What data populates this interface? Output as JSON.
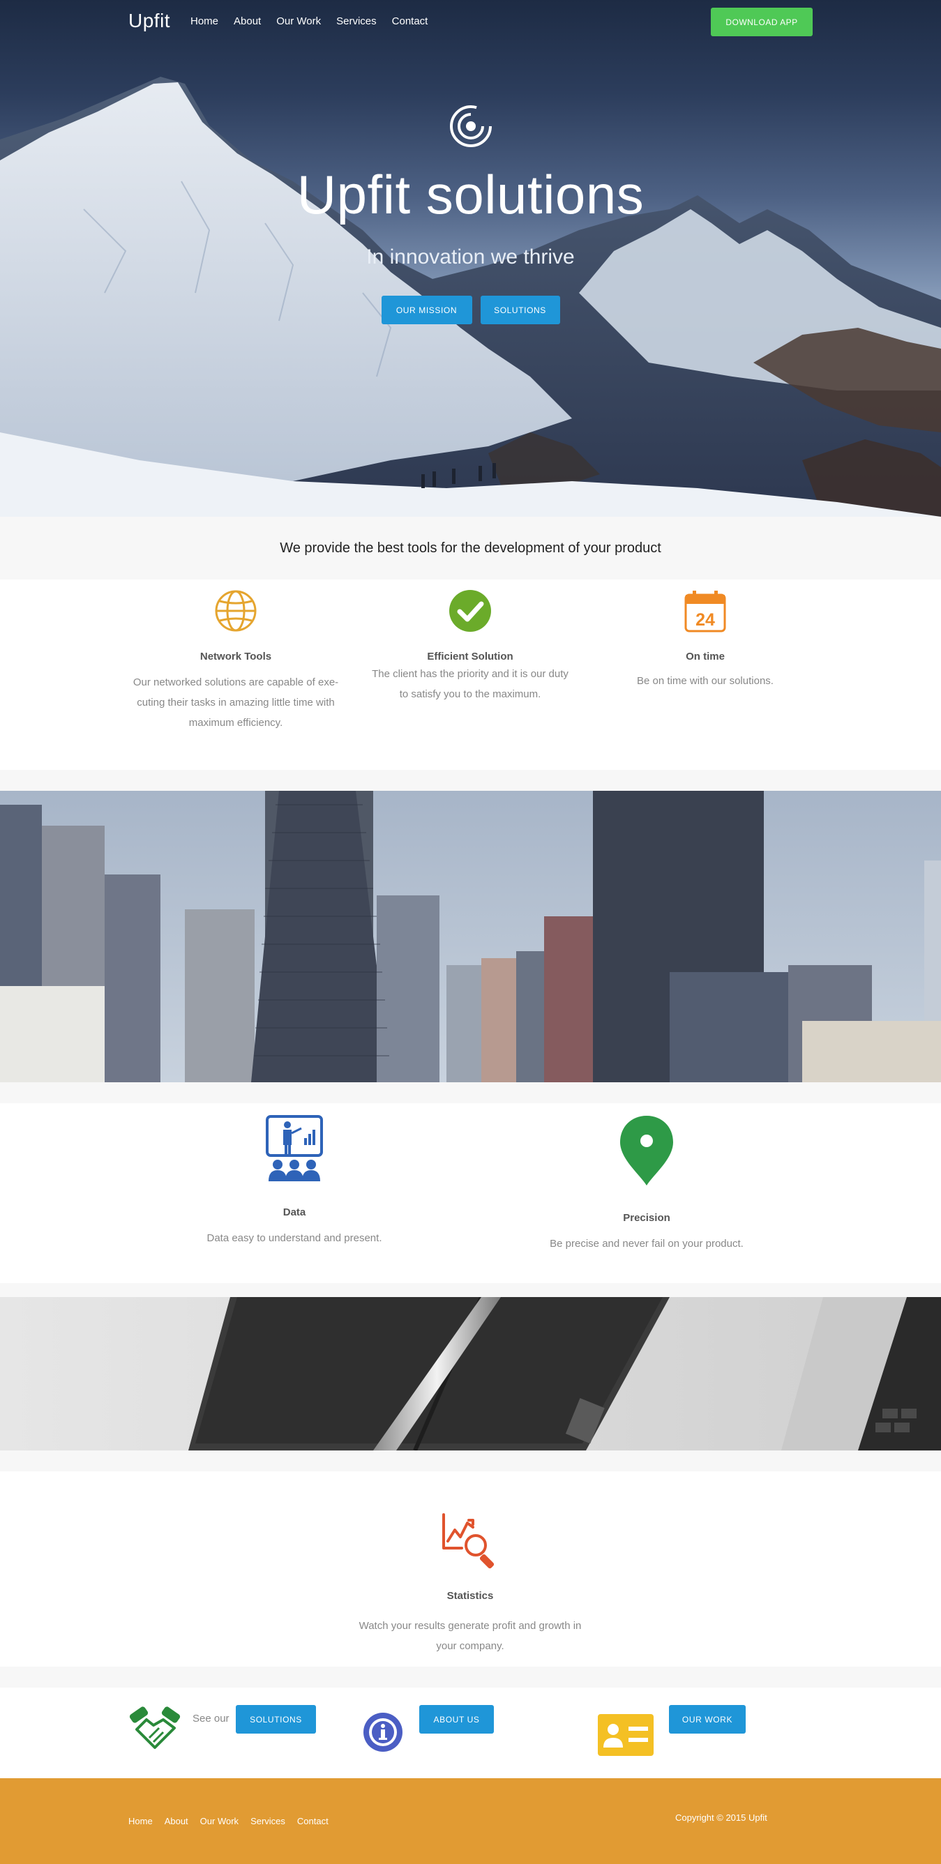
{
  "nav": {
    "brand": "Upfit",
    "links": [
      "Home",
      "About",
      "Our Work",
      "Services",
      "Contact"
    ],
    "download_label": "DOWNLOAD APP"
  },
  "hero": {
    "logo_icon": "spiral-logo-icon",
    "title": "Upfit solutions",
    "subtitle": "In innovation we thrive",
    "buttons": [
      "OUR MISSION",
      "SOLUTIONS"
    ]
  },
  "tagline": "We provide the best tools for the development of your product",
  "features": [
    {
      "icon": "globe-icon",
      "title": "Network Tools",
      "text": [
        "Our networked solutions are capable of exe-",
        "cuting their tasks in amazing little time with",
        "maximum efficiency."
      ]
    },
    {
      "icon": "checkmark-icon",
      "title": "Efficient Solution",
      "text": [
        "The client has the priority and it is our duty",
        "to satisfy you to the maximum."
      ]
    },
    {
      "icon": "calendar-icon",
      "title": "On time",
      "text": [
        "Be on time with our solutions."
      ],
      "calendar_day": "24"
    }
  ],
  "features2": [
    {
      "icon": "presentation-icon",
      "title": "Data",
      "text": "Data easy to understand and present."
    },
    {
      "icon": "map-pin-icon",
      "title": "Precision",
      "text": "Be precise and never fail on your product."
    }
  ],
  "stats": {
    "icon": "chart-magnifier-icon",
    "title": "Statistics",
    "text": "Watch your results generate profit and growth in your company."
  },
  "cta": {
    "see_our": "See our",
    "buttons": [
      "SOLUTIONS",
      "ABOUT US",
      "OUR WORK"
    ],
    "icons": [
      "handshake-icon",
      "info-icon",
      "id-card-icon"
    ]
  },
  "footer": {
    "links": [
      "Home",
      "About",
      "Our Work",
      "Services",
      "Contact"
    ],
    "copyright": "Copyright © 2015 Upfit"
  },
  "colors": {
    "green": "#4fc956",
    "blue": "#1f96d8",
    "footer": "#e19b33",
    "globe": "#e5a52f",
    "check": "#6bab2a",
    "calendar": "#f08a24",
    "presentation": "#2e63b8",
    "pin": "#2e9a47",
    "stats": "#e0532d"
  }
}
